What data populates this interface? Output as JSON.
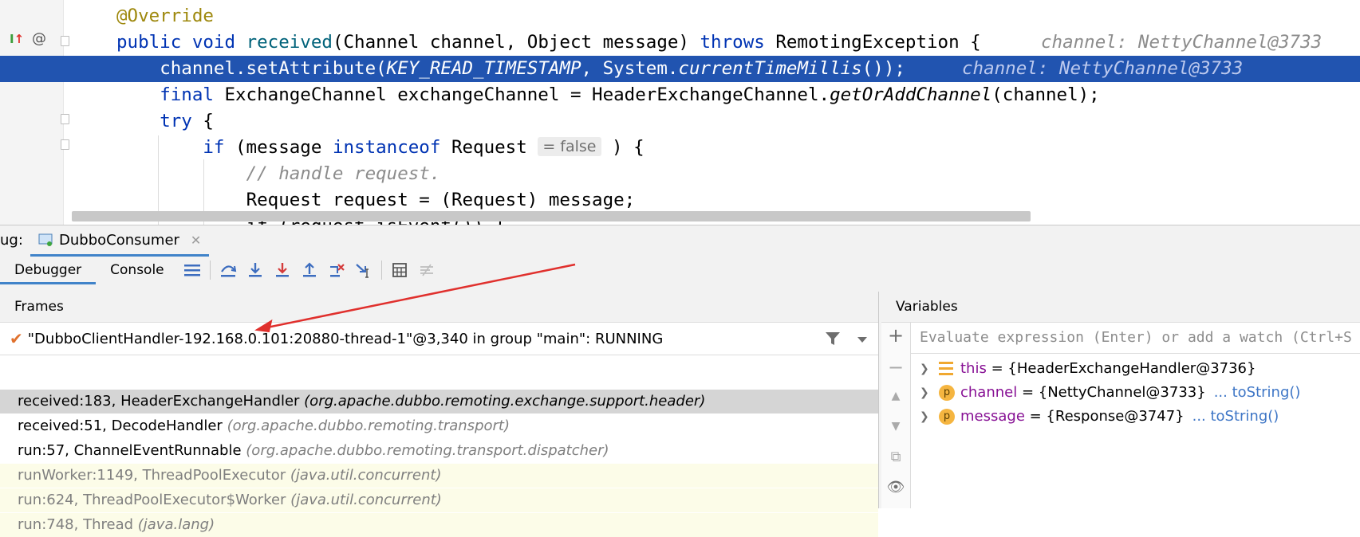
{
  "editor": {
    "lines": [
      {
        "indent": "",
        "tokens": [
          {
            "t": "@Override",
            "c": "ann"
          }
        ]
      },
      {
        "indent": "",
        "tokens": [
          {
            "t": "public ",
            "c": "kw"
          },
          {
            "t": "void ",
            "c": "kw"
          },
          {
            "t": "received",
            "c": "meth"
          },
          {
            "t": "(Channel channel, Object message) "
          },
          {
            "t": "throws ",
            "c": "kw"
          },
          {
            "t": "RemotingException {"
          }
        ],
        "hint": "channel: NettyChannel@3733"
      },
      {
        "indent": "    ",
        "tokens": [
          {
            "t": "channel.setAttribute("
          },
          {
            "t": "KEY_READ_TIMESTAMP",
            "c": "ital"
          },
          {
            "t": ", System."
          },
          {
            "t": "currentTimeMillis",
            "c": "ital"
          },
          {
            "t": "());"
          }
        ],
        "hint": "channel: NettyChannel@3733",
        "highlighted": true
      },
      {
        "indent": "    ",
        "tokens": [
          {
            "t": "final ",
            "c": "kw"
          },
          {
            "t": "ExchangeChannel exchangeChannel = HeaderExchangeChannel."
          },
          {
            "t": "getOrAddChannel",
            "c": "ital"
          },
          {
            "t": "(channel);"
          }
        ]
      },
      {
        "indent": "    ",
        "tokens": [
          {
            "t": "try ",
            "c": "kw"
          },
          {
            "t": "{"
          }
        ]
      },
      {
        "indent": "        ",
        "tokens": [
          {
            "t": "if ",
            "c": "kw"
          },
          {
            "t": "(message "
          },
          {
            "t": "instanceof ",
            "c": "kw"
          },
          {
            "t": "Request "
          }
        ],
        "inlay": "= false",
        "tail": " ) {"
      },
      {
        "indent": "            ",
        "tokens": [
          {
            "t": "// handle request.",
            "c": "cmt"
          }
        ]
      },
      {
        "indent": "            ",
        "tokens": [
          {
            "t": "Request request = (Request) message;"
          }
        ]
      },
      {
        "indent": "            ",
        "tokens": [
          {
            "t": "if (request.isEvent()) {"
          }
        ]
      }
    ]
  },
  "debug": {
    "title_label": "ug:",
    "session_tab": "DubboConsumer",
    "tabs": {
      "debugger": "Debugger",
      "console": "Console"
    },
    "frames_header": "Frames",
    "thread": "\"DubboClientHandler-192.168.0.101:20880-thread-1\"@3,340 in group \"main\": RUNNING",
    "frames": [
      {
        "method": "received:183, HeaderExchangeHandler",
        "pkg": "(org.apache.dubbo.remoting.exchange.support.header)",
        "state": "selected"
      },
      {
        "method": "received:51, DecodeHandler",
        "pkg": "(org.apache.dubbo.remoting.transport)",
        "state": "normal"
      },
      {
        "method": "run:57, ChannelEventRunnable",
        "pkg": "(org.apache.dubbo.remoting.transport.dispatcher)",
        "state": "normal"
      },
      {
        "method": "runWorker:1149, ThreadPoolExecutor",
        "pkg": "(java.util.concurrent)",
        "state": "library"
      },
      {
        "method": "run:624, ThreadPoolExecutor$Worker",
        "pkg": "(java.util.concurrent)",
        "state": "library"
      },
      {
        "method": "run:748, Thread",
        "pkg": "(java.lang)",
        "state": "library"
      }
    ],
    "variables_header": "Variables",
    "eval_placeholder": "Evaluate expression (Enter) or add a watch (Ctrl+S",
    "variables": [
      {
        "icon": "field-list-icon",
        "name": "this",
        "value": " = {HeaderExchangeHandler@3736}",
        "link": ""
      },
      {
        "icon": "p",
        "name": "channel",
        "value": " = {NettyChannel@3733}",
        "link": "... toString()"
      },
      {
        "icon": "p",
        "name": "message",
        "value": " = {Response@3747}",
        "link": "... toString()"
      }
    ]
  },
  "colors": {
    "highlight": "#2154b0",
    "accent": "#4083c9",
    "annotation_arrow": "#e0302d"
  }
}
